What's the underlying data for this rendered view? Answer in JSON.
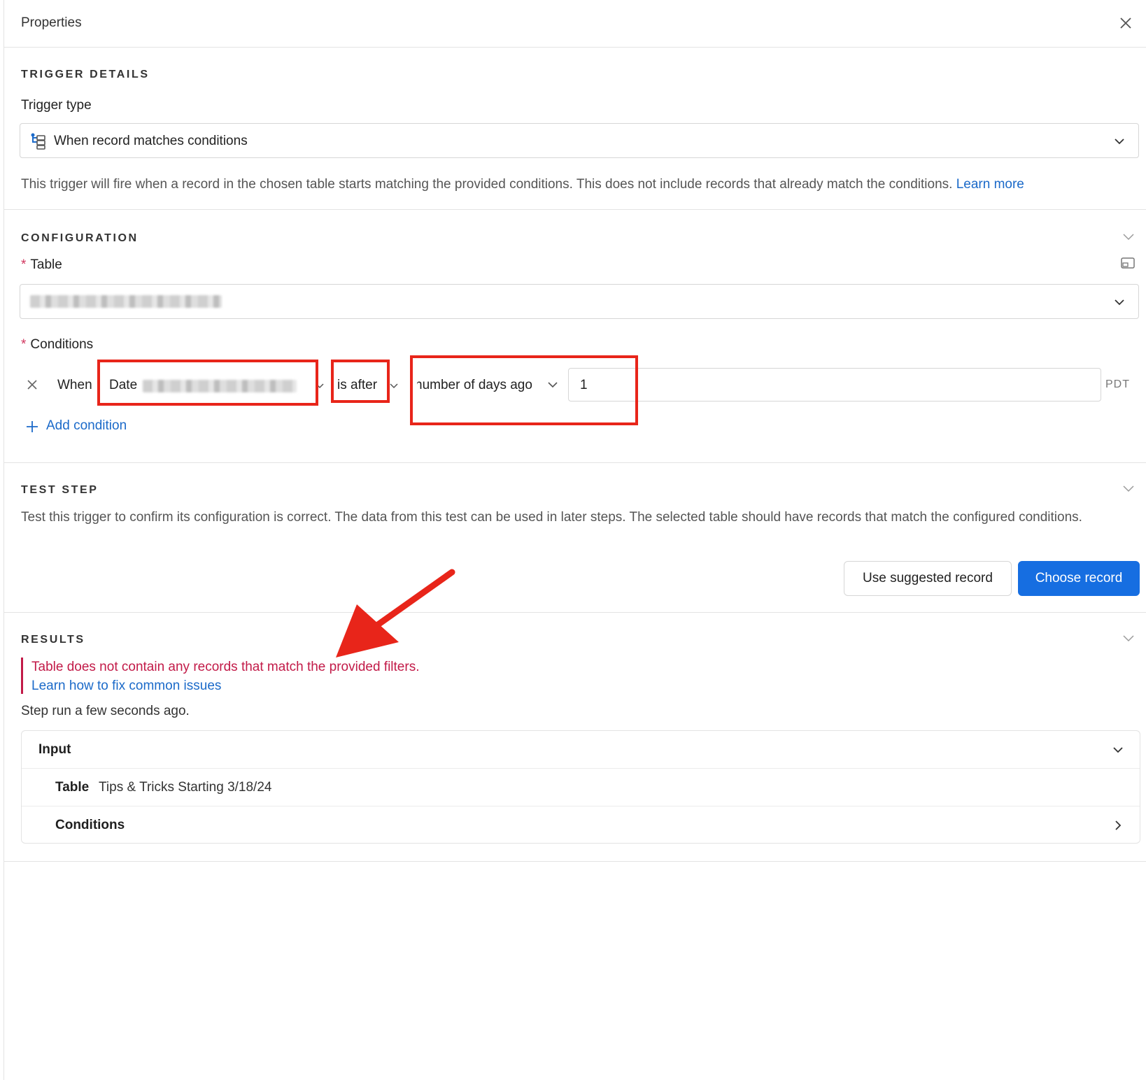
{
  "header": {
    "title": "Properties"
  },
  "trigger_details": {
    "section_title": "TRIGGER DETAILS",
    "trigger_type_label": "Trigger type",
    "trigger_type_value": "When record matches conditions",
    "description": "This trigger will fire when a record in the chosen table starts matching the provided conditions. This does not include records that already match the conditions.",
    "learn_more": "Learn more"
  },
  "configuration": {
    "section_title": "CONFIGURATION",
    "table_label": "Table",
    "conditions_label": "Conditions",
    "condition": {
      "when": "When",
      "field": "Date",
      "operator": "is after",
      "mode": "number of days ago",
      "value": "1",
      "timezone": "PDT"
    },
    "add_condition": "Add condition"
  },
  "test_step": {
    "section_title": "TEST STEP",
    "description": "Test this trigger to confirm its configuration is correct. The data from this test can be used in later steps. The selected table should have records that match the configured conditions.",
    "use_suggested": "Use suggested record",
    "choose_record": "Choose record"
  },
  "results": {
    "section_title": "RESULTS",
    "error": "Table does not contain any records that match the provided filters.",
    "fix_link": "Learn how to fix common issues",
    "step_run": "Step run a few seconds ago.",
    "input_label": "Input",
    "table_key": "Table",
    "table_value": "Tips & Tricks Starting 3/18/24",
    "conditions_label": "Conditions"
  },
  "colors": {
    "accent": "#166ee1",
    "link": "#1b6ac9",
    "error": "#c21a48",
    "annotation": "#e8251a"
  }
}
